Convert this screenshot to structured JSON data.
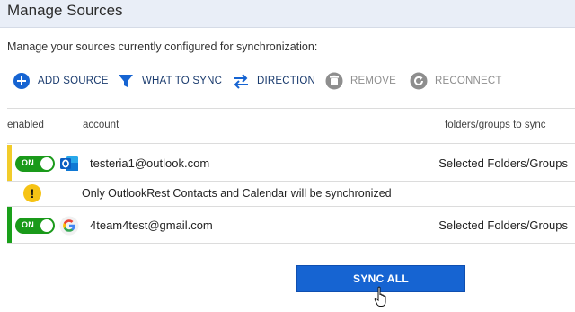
{
  "window": {
    "title": "Manage Sources"
  },
  "description": "Manage your sources currently configured for synchronization:",
  "toolbar": {
    "add_source": "ADD SOURCE",
    "what_to_sync": "WHAT TO SYNC",
    "direction": "DIRECTION",
    "remove": "REMOVE",
    "reconnect": "RECONNECT"
  },
  "columns": {
    "enabled": "enabled",
    "account": "account",
    "folders": "folders/groups to sync"
  },
  "sources": [
    {
      "toggle_label": "ON",
      "account": "testeria1@outlook.com",
      "folders": "Selected Folders/Groups",
      "provider_icon": "outlook-icon",
      "status_color": "#f2cc2a"
    },
    {
      "toggle_label": "ON",
      "account": "4team4test@gmail.com",
      "folders": "Selected Folders/Groups",
      "provider_icon": "google-icon",
      "status_color": "#1aa01a"
    }
  ],
  "warning": {
    "icon": "!",
    "text": "Only OutlookRest Contacts and Calendar will be synchronized"
  },
  "sync_button": "SYNC ALL",
  "colors": {
    "accent_blue": "#1664d2",
    "toggle_green": "#1a9a1a",
    "warning_yellow": "#f6c315"
  }
}
